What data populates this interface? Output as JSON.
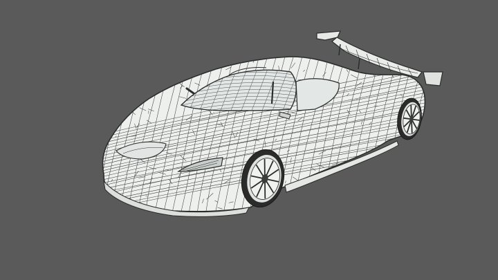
{
  "scene": {
    "subject_icon": "car-wireframe-icon",
    "colors": {
      "background": "#5a5a5a",
      "surface": "#eef0ee",
      "surface_shadow": "#d6d9d6",
      "wire": "#2a2d2c",
      "glass": "#dfe3e2",
      "tire": "#2b2b2b"
    }
  }
}
